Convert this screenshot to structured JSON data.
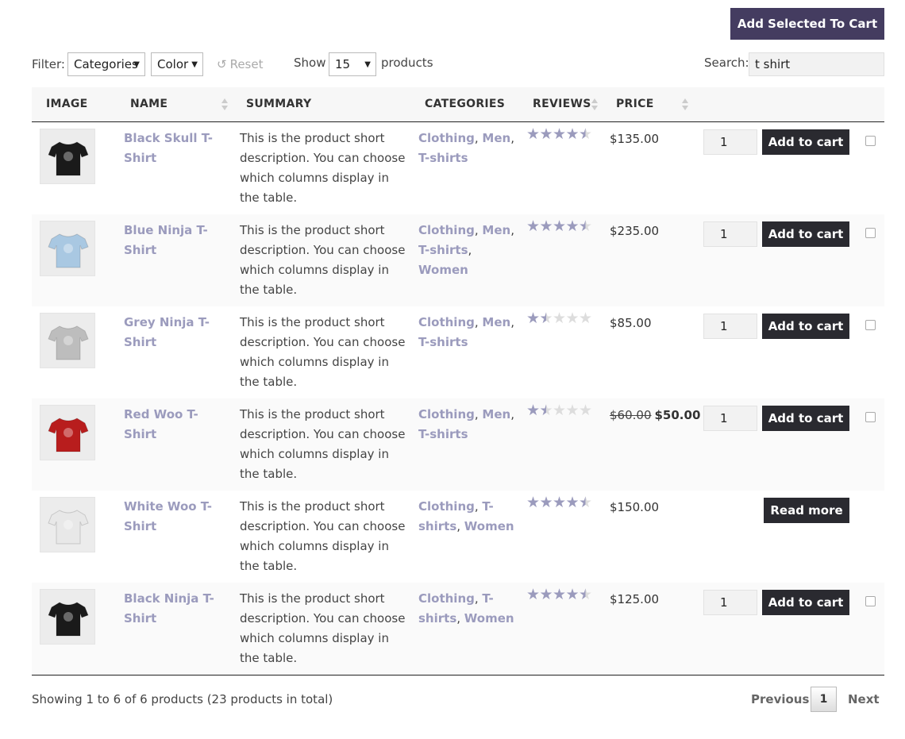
{
  "top_button": "Add Selected To Cart",
  "toolbar": {
    "filter_label": "Filter:",
    "categories_select": "Categories",
    "color_select": "Color",
    "reset_label": "Reset",
    "show_label": "Show",
    "show_value": "15",
    "products_label": "products",
    "search_label": "Search:",
    "search_value": "t shirt"
  },
  "columns": {
    "image": "IMAGE",
    "name": "NAME",
    "summary": "SUMMARY",
    "categories": "CATEGORIES",
    "reviews": "REVIEWS",
    "price": "PRICE"
  },
  "rows": [
    {
      "name": "Black Skull T-Shirt",
      "shirt_color": "#1a1a1a",
      "summary": "This is the product short description. You can choose which columns display in the table.",
      "categories": [
        "Clothing",
        "Men",
        "T-shirts"
      ],
      "rating": 4.5,
      "price": "$135.00",
      "old_price": "",
      "qty": "1",
      "button": "Add to cart"
    },
    {
      "name": "Blue Ninja T-Shirt",
      "shirt_color": "#a9c8e2",
      "summary": "This is the product short description. You can choose which columns display in the table.",
      "categories": [
        "Clothing",
        "Men",
        "T-shirts",
        "Women"
      ],
      "rating": 4.5,
      "price": "$235.00",
      "old_price": "",
      "qty": "1",
      "button": "Add to cart"
    },
    {
      "name": "Grey Ninja T-Shirt",
      "shirt_color": "#bdbdbd",
      "summary": "This is the product short description. You can choose which columns display in the table.",
      "categories": [
        "Clothing",
        "Men",
        "T-shirts"
      ],
      "rating": 1.5,
      "price": "$85.00",
      "old_price": "",
      "qty": "1",
      "button": "Add to cart"
    },
    {
      "name": "Red Woo T-Shirt",
      "shirt_color": "#b81d1d",
      "summary": "This is the product short description. You can choose which columns display in the table.",
      "categories": [
        "Clothing",
        "Men",
        "T-shirts"
      ],
      "rating": 1.5,
      "price": "$50.00",
      "old_price": "$60.00",
      "qty": "1",
      "button": "Add to cart"
    },
    {
      "name": "White Woo T-Shirt",
      "shirt_color": "#e8e8e8",
      "summary": "This is the product short description. You can choose which columns display in the table.",
      "categories": [
        "Clothing",
        "T-shirts",
        "Women"
      ],
      "rating": 4.5,
      "price": "$150.00",
      "old_price": "",
      "qty": "",
      "button": "Read more"
    },
    {
      "name": "Black Ninja T-Shirt",
      "shirt_color": "#1a1a1a",
      "summary": "This is the product short description. You can choose which columns display in the table.",
      "categories": [
        "Clothing",
        "T-shirts",
        "Women"
      ],
      "rating": 4.5,
      "price": "$125.00",
      "old_price": "",
      "qty": "1",
      "button": "Add to cart"
    }
  ],
  "footer": {
    "info": "Showing 1 to 6 of 6 products (23 products in total)",
    "previous": "Previous",
    "page": "1",
    "next": "Next"
  },
  "colors": {
    "accent": "#443c60",
    "link": "#9b9bbd",
    "button": "#2a2a30"
  }
}
